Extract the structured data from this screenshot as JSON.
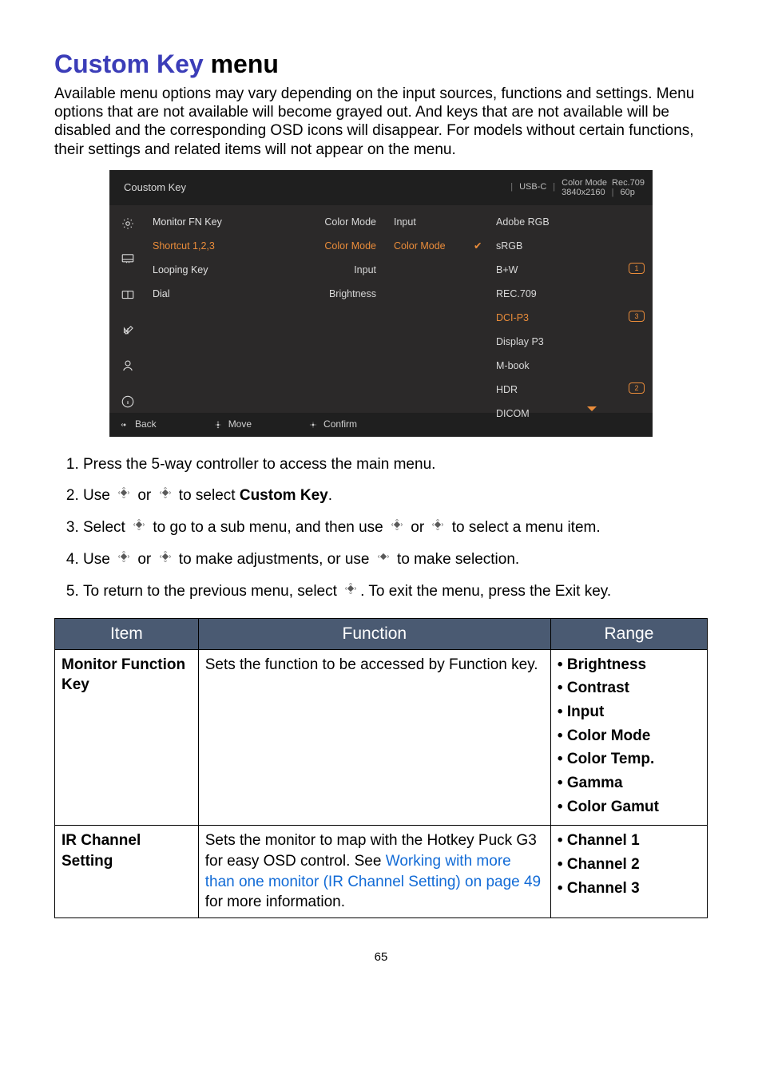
{
  "title_accent": "Custom Key",
  "title_rest": " menu",
  "intro": "Available menu options may vary depending on the input sources, functions and settings. Menu options that are not available will become grayed out. And keys that are not available will be disabled and the corresponding OSD icons will disappear. For models without certain functions, their settings and related items will not appear on the menu.",
  "osd": {
    "title": "Coustom Key",
    "hdr_input": "USB-C",
    "hdr_cm_lbl": "Color Mode",
    "hdr_cm_val": "Rec.709",
    "hdr_res": "3840x2160",
    "hdr_refresh": "60p",
    "col1": [
      "Monitor FN Key",
      "Shortcut 1,2,3",
      "Looping Key",
      "Dial"
    ],
    "col1_sel_index": 1,
    "col2": [
      "Color Mode",
      "Color Mode",
      "Input",
      "Brightness"
    ],
    "col2_sel_index": 1,
    "col3": [
      "Input",
      "Color Mode"
    ],
    "col3_sel_index": 1,
    "check_index": 1,
    "col5": [
      "Adobe RGB",
      "sRGB",
      "B+W",
      "REC.709",
      "DCI-P3",
      "Display P3",
      "M-book",
      "HDR",
      "DICOM"
    ],
    "col5_sel_index": 4,
    "badges": {
      "2": "1",
      "4": "3",
      "7": "2"
    },
    "footer": {
      "back": "Back",
      "move": "Move",
      "confirm": "Confirm"
    }
  },
  "steps": {
    "s1": "Press the 5-way controller to access the main menu.",
    "s2a": "Use ",
    "s2b": " or ",
    "s2c": " to select ",
    "s2d": "Custom Key",
    "s2e": ".",
    "s3a": "Select ",
    "s3b": " to go to a sub menu, and then use ",
    "s3c": " or ",
    "s3d": " to select a menu item.",
    "s4a": "Use ",
    "s4b": " or ",
    "s4c": " to make adjustments, or use ",
    "s4d": " to make selection.",
    "s5a": "To return to the previous menu, select ",
    "s5b": ". To exit the menu, press the Exit key."
  },
  "table": {
    "h_item": "Item",
    "h_func": "Function",
    "h_range": "Range",
    "rows": [
      {
        "item": "Monitor Function Key",
        "func": "Sets the function to be accessed by Function key.",
        "range": [
          "Brightness",
          "Contrast",
          "Input",
          "Color Mode",
          "Color Temp.",
          "Gamma",
          "Color Gamut"
        ]
      },
      {
        "item": "IR Channel Setting",
        "func_a": "Sets the monitor to map with the Hotkey Puck G3 for easy OSD control. See ",
        "func_link": "Working with more than one monitor (IR Channel Setting) on page 49",
        "func_b": " for more information.",
        "range": [
          "Channel 1",
          "Channel 2",
          "Channel 3"
        ]
      }
    ]
  },
  "pagenum": "65"
}
